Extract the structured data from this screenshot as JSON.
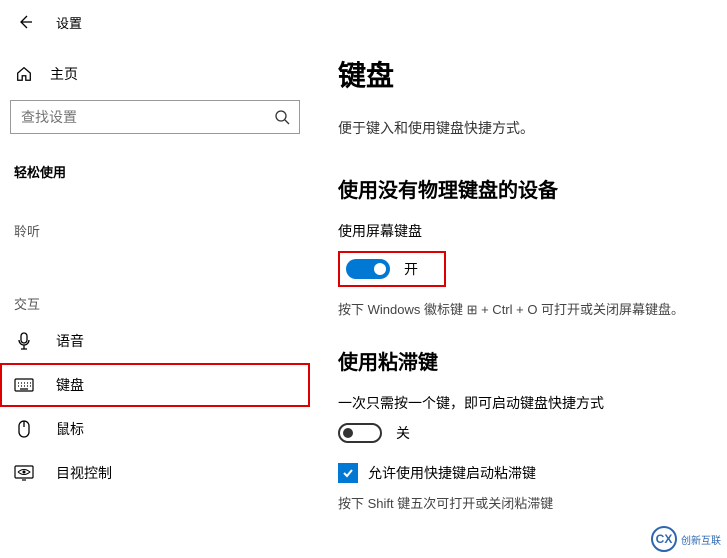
{
  "header": {
    "title": "设置"
  },
  "sidebar": {
    "home_label": "主页",
    "search_placeholder": "查找设置",
    "category": "轻松使用",
    "groups": [
      {
        "title": "聆听"
      },
      {
        "title": "交互"
      }
    ],
    "interaction_items": [
      {
        "key": "voice",
        "label": "语音"
      },
      {
        "key": "keyboard",
        "label": "键盘"
      },
      {
        "key": "mouse",
        "label": "鼠标"
      },
      {
        "key": "eye-control",
        "label": "目视控制"
      }
    ]
  },
  "main": {
    "page_title": "键盘",
    "subtitle": "便于键入和使用键盘快捷方式。",
    "section_osk": {
      "heading": "使用没有物理键盘的设备",
      "toggle_label": "使用屏幕键盘",
      "toggle_state_text": "开",
      "hint_prefix": "按下 Windows 徽标键 ",
      "hint_suffix": " + Ctrl + O 可打开或关闭屏幕键盘。"
    },
    "section_sticky": {
      "heading": "使用粘滞键",
      "toggle_label": "一次只需按一个键，即可启动键盘快捷方式",
      "toggle_state_text": "关",
      "checkbox_label": "允许使用快捷键启动粘滞键",
      "hint": "按下 Shift 键五次可打开或关闭粘滞键"
    }
  },
  "watermark": {
    "mark": "CX",
    "text": "创新互联"
  }
}
